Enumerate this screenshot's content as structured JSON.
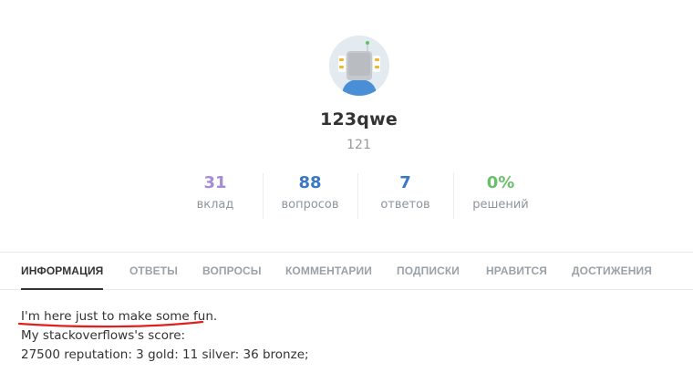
{
  "profile": {
    "avatar_icon": "robot-avatar-icon",
    "username": "123qwe",
    "rating": "121"
  },
  "stats": [
    {
      "value": "31",
      "label": "вклад",
      "color": "#a78bd6"
    },
    {
      "value": "88",
      "label": "вопросов",
      "color": "#3b78c4"
    },
    {
      "value": "7",
      "label": "ответов",
      "color": "#3b78c4"
    },
    {
      "value": "0%",
      "label": "решений",
      "color": "#6cbf6a"
    }
  ],
  "tabs": [
    {
      "label": "ИНФОРМАЦИЯ",
      "active": true
    },
    {
      "label": "ОТВЕТЫ",
      "active": false
    },
    {
      "label": "ВОПРОСЫ",
      "active": false
    },
    {
      "label": "КОММЕНТАРИИ",
      "active": false
    },
    {
      "label": "ПОДПИСКИ",
      "active": false
    },
    {
      "label": "НРАВИТСЯ",
      "active": false
    },
    {
      "label": "ДОСТИЖЕНИЯ",
      "active": false
    }
  ],
  "about": {
    "lines": [
      "I'm here just to make some fun.",
      "My stackoverflows's score:",
      "27500 reputation: 3 gold: 11 silver: 36 bronze;"
    ],
    "annotation_color": "#e0201d"
  }
}
